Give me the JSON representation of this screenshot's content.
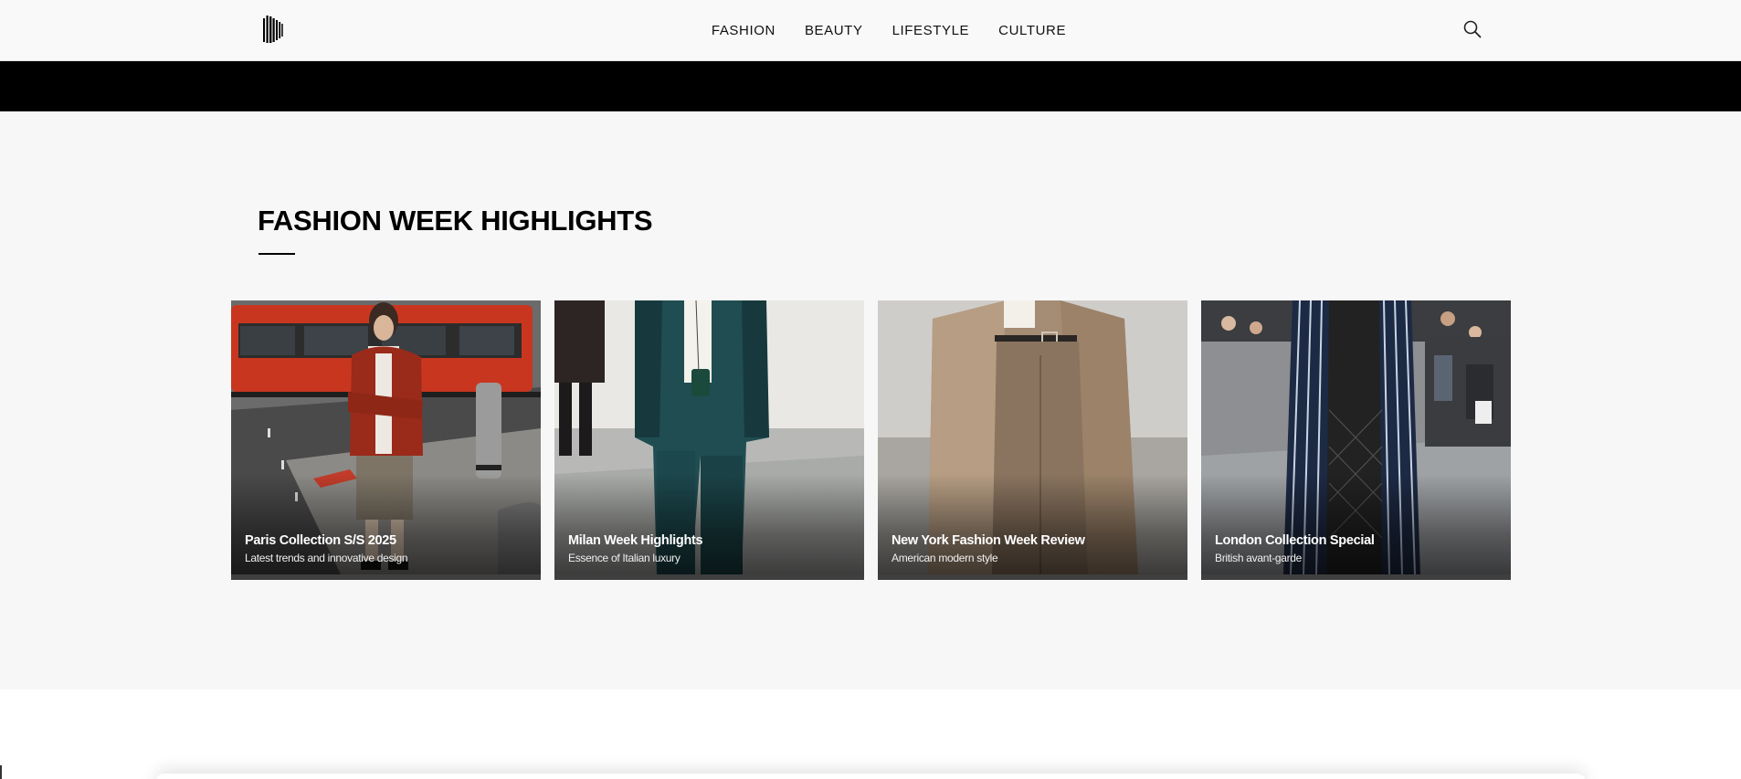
{
  "header": {
    "logo_icon": "barcode-brush-logo",
    "nav": [
      {
        "label": "FASHION"
      },
      {
        "label": "BEAUTY"
      },
      {
        "label": "LIFESTYLE"
      },
      {
        "label": "CULTURE"
      }
    ],
    "search_icon": "search-icon"
  },
  "section": {
    "title": "FASHION WEEK HIGHLIGHTS",
    "cards": [
      {
        "title": "Paris Collection S/S 2025",
        "subtitle": "Latest trends and innovative design"
      },
      {
        "title": "Milan Week Highlights",
        "subtitle": "Essence of Italian luxury"
      },
      {
        "title": "New York Fashion Week Review",
        "subtitle": "American modern style"
      },
      {
        "title": "London Collection Special",
        "subtitle": "British avant-garde"
      }
    ]
  },
  "colors": {
    "header_bg": "#f9f9f9",
    "banner_bg": "#000000",
    "section_bg": "#f7f7f7",
    "text": "#111111"
  }
}
